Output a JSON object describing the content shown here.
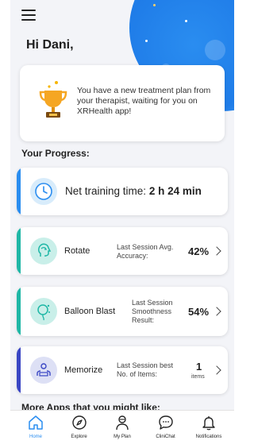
{
  "greeting": "Hi Dani,",
  "notification_card": {
    "message": "You have a new treatment plan from your therapist, waiting for you on XRHealth app!",
    "icon": "trophy-icon"
  },
  "progress": {
    "title": "Your Progress:",
    "training": {
      "label": "Net training time:",
      "value": "2 h 24 min",
      "icon": "clock-icon"
    },
    "apps": [
      {
        "name": "Rotate",
        "metric_label": "Last Session Avg. Accuracy:",
        "value": "42%",
        "unit": "",
        "icon": "head-rotate-icon",
        "accent": "#1fb7a6"
      },
      {
        "name": "Balloon Blast",
        "metric_label": "Last Session Smoothness Result:",
        "value": "54%",
        "unit": "",
        "icon": "balloon-icon",
        "accent": "#1fb7a6"
      },
      {
        "name": "Memorize",
        "metric_label": "Last Session best No. of Items:",
        "value": "1",
        "unit": "items",
        "icon": "memory-icon",
        "accent": "#3a46c4"
      }
    ]
  },
  "more_apps_title": "More Apps that you might like:",
  "colors": {
    "primary": "#2a8df0",
    "teal": "#1fb7a6",
    "indigo": "#3a46c4",
    "background": "#f3f4f8"
  },
  "bottom_nav": [
    {
      "label": "Home",
      "icon": "home-icon",
      "active": true
    },
    {
      "label": "Explore",
      "icon": "compass-icon",
      "active": false
    },
    {
      "label": "My Plan",
      "icon": "person-icon",
      "active": false
    },
    {
      "label": "CliniChat",
      "icon": "chat-icon",
      "active": false
    },
    {
      "label": "Notifications",
      "icon": "bell-icon",
      "active": false
    }
  ]
}
